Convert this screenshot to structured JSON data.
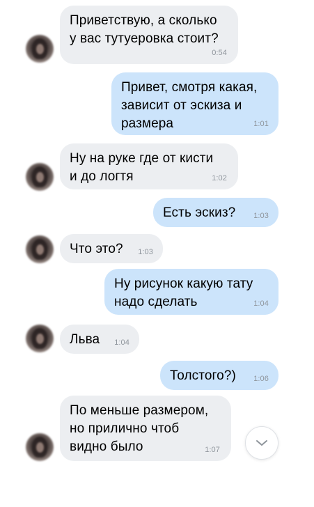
{
  "messages": [
    {
      "from": "incoming",
      "text": "Приветствую, а сколько\nу вас тутуеровка стоит?",
      "time": "0:54"
    },
    {
      "from": "outgoing",
      "text": "Привет, смотря какая,\nзависит от эскиза и\nразмера",
      "time": "1:01"
    },
    {
      "from": "incoming",
      "text": "Ну на руке где от кисти\nи до логтя",
      "time": "1:02"
    },
    {
      "from": "outgoing",
      "text": "Есть эскиз?",
      "time": "1:03"
    },
    {
      "from": "incoming",
      "text": "Что это?",
      "time": "1:03"
    },
    {
      "from": "outgoing",
      "text": "Ну рисунок какую тату\nнадо сделать",
      "time": "1:04"
    },
    {
      "from": "incoming",
      "text": "Льва",
      "time": "1:04"
    },
    {
      "from": "outgoing",
      "text": "Толстого?)",
      "time": "1:06"
    },
    {
      "from": "incoming",
      "text": "По меньше размером,\nно прилично чтоб\nвидно было",
      "time": "1:07"
    }
  ],
  "icons": {
    "avatar": "contact-avatar",
    "scroll": "chevron-down-icon"
  },
  "colors": {
    "incoming_bubble": "#eceef1",
    "outgoing_bubble": "#cce4fb",
    "timestamp": "#8f959c"
  }
}
